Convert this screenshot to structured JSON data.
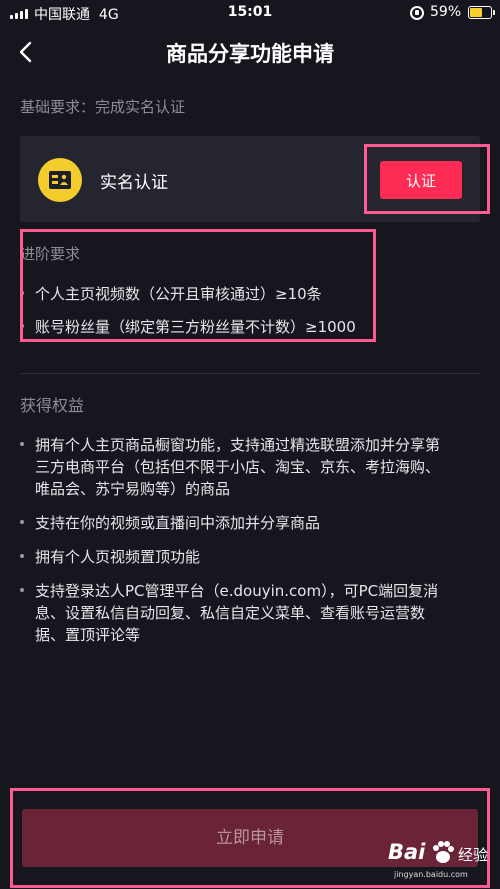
{
  "status_bar": {
    "carrier": "中国联通",
    "network": "4G",
    "time": "15:01",
    "battery": "59%"
  },
  "nav": {
    "title": "商品分享功能申请"
  },
  "basic_requirement": "基础要求：完成实名认证",
  "verification": {
    "label": "实名认证",
    "button": "认证"
  },
  "advanced": {
    "title": "进阶要求",
    "items": [
      "个人主页视频数（公开且审核通过）≥10条",
      "账号粉丝量（绑定第三方粉丝量不计数）≥1000"
    ]
  },
  "benefits": {
    "title": "获得权益",
    "items": [
      {
        "lines": [
          "拥有个人主页商品橱窗功能，支持通过精选联盟添加并分享第",
          "三方电商平台（包括但不限于小店、淘宝、京东、考拉海购、",
          "唯品会、苏宁易购等）的商品"
        ]
      },
      {
        "lines": [
          "支持在你的视频或直播间中添加并分享商品"
        ]
      },
      {
        "lines": [
          "拥有个人页视频置顶功能"
        ]
      },
      {
        "lines": [
          "支持登录达人PC管理平台（e.douyin.com），可PC端回复消",
          "息、设置私信自动回复、私信自定义菜单、查看账号运营数",
          "据、置顶评论等"
        ]
      }
    ]
  },
  "apply_button": "立即申请",
  "watermark": {
    "brand": "Bai",
    "jingyan": "经验",
    "url": "jingyan.baidu.com"
  },
  "colors": {
    "background": "#16161f",
    "card": "#25252f",
    "accent": "#fe2c55",
    "highlight": "#ff5a92",
    "id_icon": "#f3cc2d"
  }
}
